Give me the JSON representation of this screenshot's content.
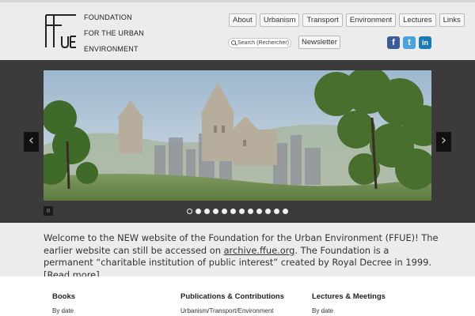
{
  "header": {
    "logo_mark": "FFUE",
    "logo_lines": [
      "FOUNDATION",
      "FOR THE URBAN",
      "ENVIRONMENT"
    ],
    "nav": [
      "About",
      "Urbanism",
      "Transport",
      "Environment",
      "Lectures",
      "Links"
    ],
    "search_placeholder": "Search (Rechercher)",
    "newsletter": "Newsletter",
    "social": [
      {
        "icon": "facebook-icon",
        "glyph": "f",
        "color": "#3b5b98"
      },
      {
        "icon": "twitter-icon",
        "glyph": "t",
        "color": "#4ba3dc"
      },
      {
        "icon": "linkedin-icon",
        "glyph": "in",
        "color": "#1a7bb4"
      }
    ]
  },
  "slider": {
    "prev": "‹",
    "next": "›",
    "pause": "II",
    "dot_count": 12,
    "active_dot": 0
  },
  "intro": {
    "text_1": "Welcome to the NEW website of the Foundation for the Urban Environment (FFUE)! The earlier website can still be accessed on ",
    "archive_link": "archive.ffue.org",
    "text_2": ". The Foundation is a permanent “charitable institution of public interest” created by Royal Decree in 1999. ",
    "read_more": "[Read more]"
  },
  "columns": [
    {
      "title": "Books",
      "link": "By date"
    },
    {
      "title": "Publications & Contributions",
      "link": "Urbanism/Transport/Environment"
    },
    {
      "title": "Lectures & Meetings",
      "link": "By date"
    }
  ]
}
